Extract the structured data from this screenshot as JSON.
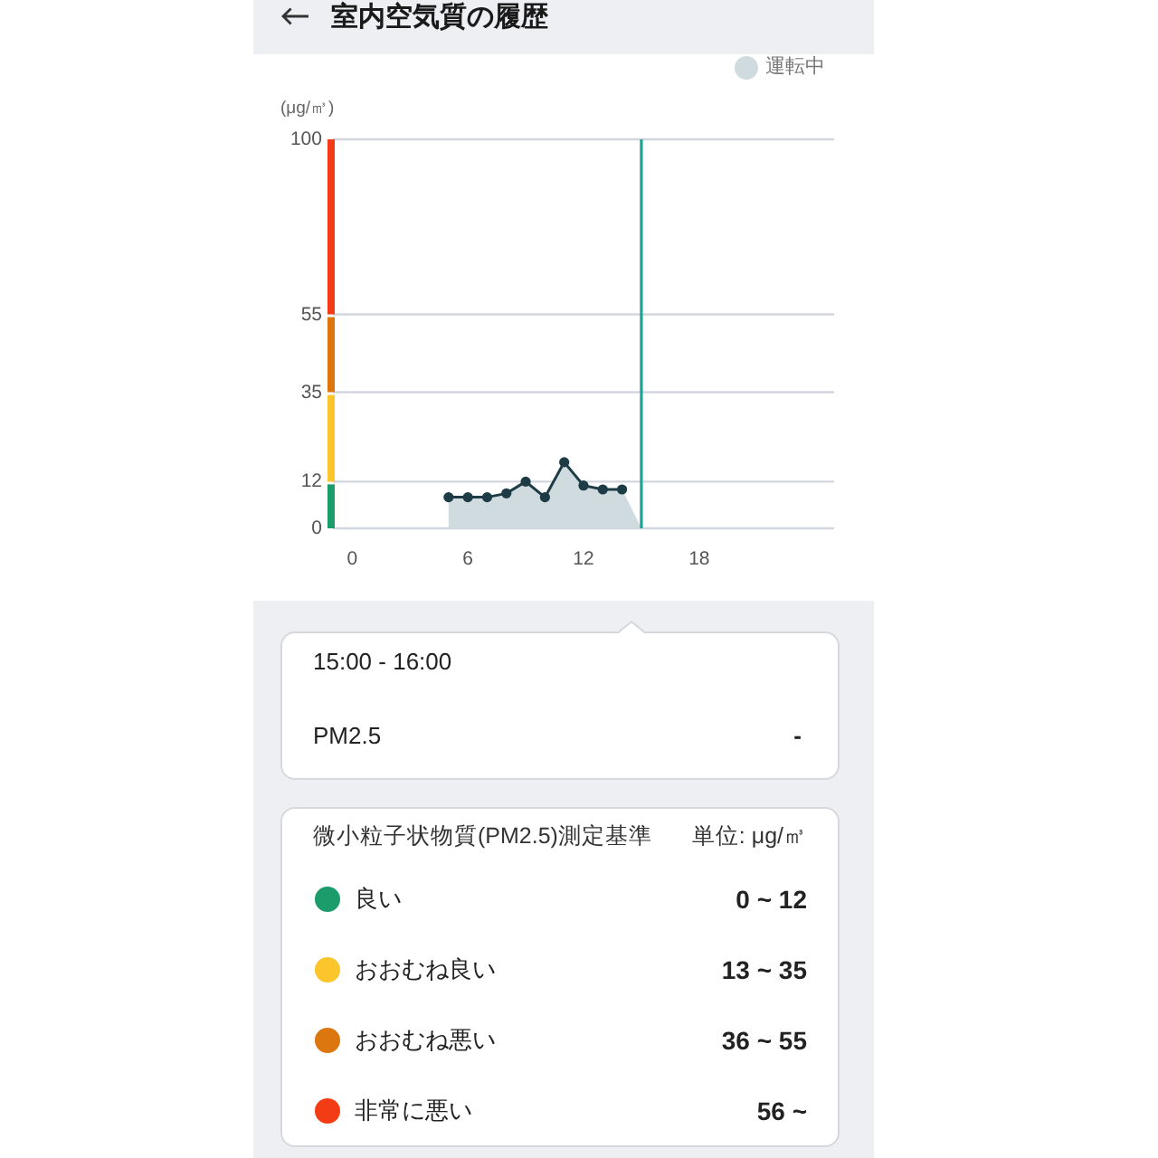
{
  "header": {
    "title": "室内空気質の履歴"
  },
  "chart": {
    "chart_data": {
      "type": "area",
      "ylabel": "(μg/㎥)",
      "x": [
        5,
        6,
        7,
        8,
        9,
        10,
        11,
        12,
        13,
        14,
        15
      ],
      "series": [
        {
          "name": "運転中",
          "color": "#cfdbde",
          "values": [
            8,
            8,
            8,
            9,
            12,
            8,
            17,
            11,
            10,
            10,
            0
          ]
        }
      ],
      "xlim": [
        -1,
        25
      ],
      "ylim": [
        0,
        100
      ],
      "xticks": [
        0,
        6,
        12,
        18
      ],
      "yticks": [
        0,
        12,
        35,
        55,
        100
      ],
      "grid": true,
      "ref_lines": [
        {
          "axis": "x",
          "value": 15
        }
      ]
    }
  },
  "tooltip": {
    "time": "15:00 - 16:00",
    "rows": [
      {
        "label": "PM2.5",
        "value": "-"
      }
    ]
  },
  "standards": {
    "title": "微小粒子状物質(PM2.5)測定基準",
    "unit": "単位: μg/㎥",
    "levels": [
      {
        "label": "良い",
        "range": "0 ~ 12",
        "color": "#1c9c6b"
      },
      {
        "label": "おおむね良い",
        "range": "13 ~ 35",
        "color": "#fbc52b"
      },
      {
        "label": "おおむね悪い",
        "range": "36 ~ 55",
        "color": "#dc760f"
      },
      {
        "label": "非常に悪い",
        "range": "56 ~",
        "color": "#f33b16"
      }
    ]
  }
}
